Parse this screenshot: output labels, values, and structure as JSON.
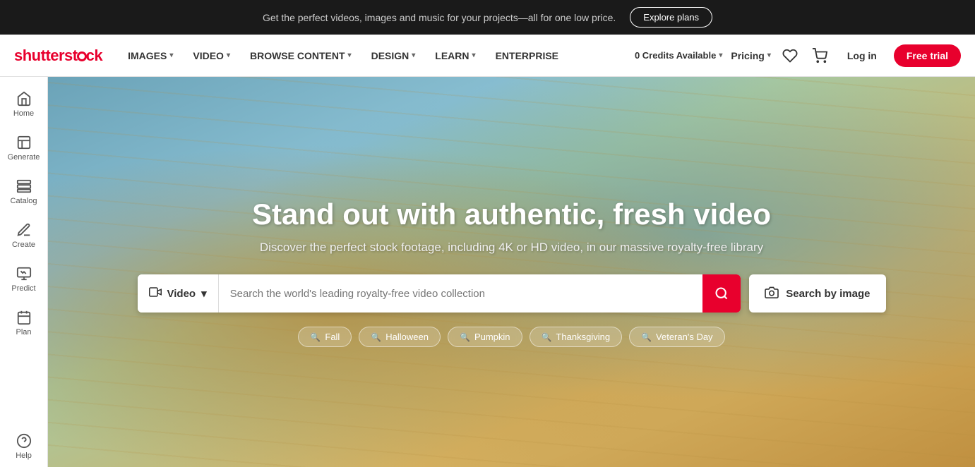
{
  "banner": {
    "text": "Get the perfect videos, images and music for your projects—all for one low price.",
    "explore_label": "Explore plans"
  },
  "nav": {
    "logo": "shutterstock",
    "items": [
      {
        "label": "IMAGES",
        "has_dropdown": true
      },
      {
        "label": "VIDEO",
        "has_dropdown": true
      },
      {
        "label": "BROWSE CONTENT",
        "has_dropdown": true
      },
      {
        "label": "DESIGN",
        "has_dropdown": true
      },
      {
        "label": "LEARN",
        "has_dropdown": true
      },
      {
        "label": "ENTERPRISE",
        "has_dropdown": false
      }
    ],
    "credits": "0 Credits Available",
    "pricing": "Pricing",
    "login": "Log in",
    "free_trial": "Free trial"
  },
  "sidebar": {
    "items": [
      {
        "label": "Home",
        "icon": "home"
      },
      {
        "label": "Generate",
        "icon": "generate"
      },
      {
        "label": "Catalog",
        "icon": "catalog"
      },
      {
        "label": "Create",
        "icon": "create"
      },
      {
        "label": "Predict",
        "icon": "predict"
      },
      {
        "label": "Plan",
        "icon": "plan"
      }
    ],
    "bottom": [
      {
        "label": "Help",
        "icon": "help"
      }
    ]
  },
  "hero": {
    "title": "Stand out with authentic, fresh video",
    "subtitle": "Discover the perfect stock footage, including 4K or HD video, in our massive royalty-free library",
    "search": {
      "type_label": "Video",
      "placeholder": "Search the world's leading royalty-free video collection",
      "search_by_image_label": "Search by image"
    },
    "tags": [
      {
        "label": "Fall"
      },
      {
        "label": "Halloween"
      },
      {
        "label": "Pumpkin"
      },
      {
        "label": "Thanksgiving"
      },
      {
        "label": "Veteran's Day"
      }
    ]
  }
}
